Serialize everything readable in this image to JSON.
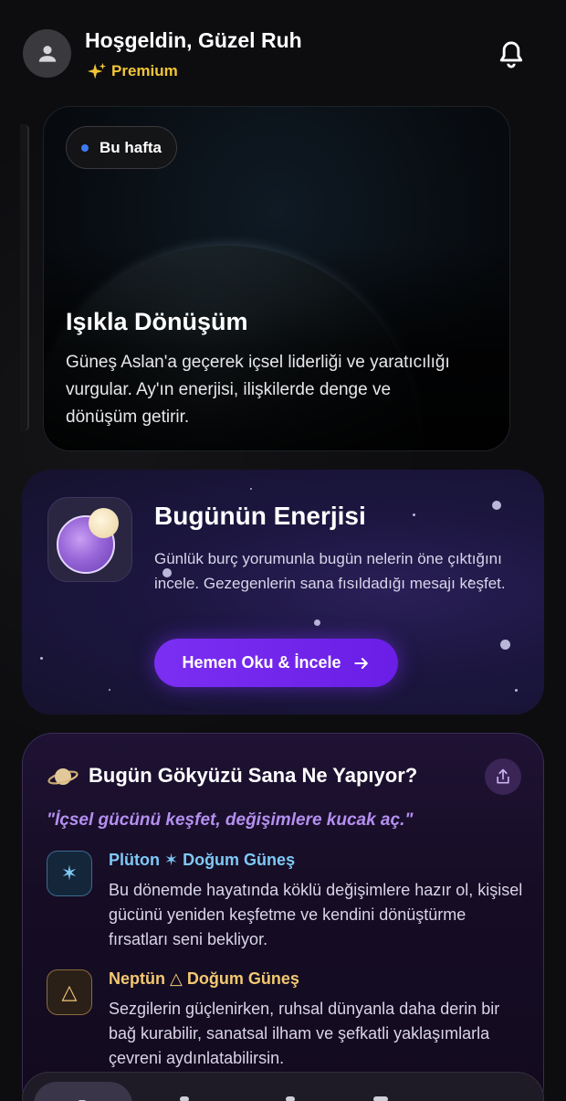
{
  "header": {
    "greeting": "Hoşgeldin, Güzel Ruh",
    "premium_label": "Premium",
    "icons": [
      "user-avatar-icon",
      "sparkles-icon",
      "bell-icon"
    ],
    "accent": "#f3c536"
  },
  "hero": {
    "chip_label": "Bu hafta",
    "title": "Işıkla Dönüşüm",
    "description": "Güneş Aslan'a geçerek içsel liderliği ve yaratıcılığı vurgular. Ay'ın enerjisi, ilişkilerde denge ve dönüşüm getirir.",
    "chip_dot_color": "#3d7bf5"
  },
  "energy": {
    "title": "Bugünün Enerjisi",
    "description": "Günlük burç yorumunla bugün nelerin öne çıktığını incele. Gezegenlerin sana fısıldadığı mesajı keşfet.",
    "button_label": "Hemen Oku & İncele",
    "button_arrow": "→",
    "button_color": "#7b2ff2"
  },
  "sky": {
    "title": "Bugün Gökyüzü Sana Ne Yapıyor?",
    "quote": "\"İçsel gücünü keşfet, değişimlere kucak aç.\"",
    "transits": [
      {
        "symbol": "✶",
        "title": "Plüton ✶ Doğum Güneş",
        "text": "Bu dönemde hayatında köklü değişimlere hazır ol, kişisel gücünü yeniden keşfetme ve kendini dönüştürme fırsatları seni bekliyor.",
        "color": "#7ec9f5"
      },
      {
        "symbol": "△",
        "title": "Neptün △ Doğum Güneş",
        "text": "Sezgilerin güçlenirken, ruhsal dünyanla daha derin bir bağ kurabilir, sanatsal ilham ve şefkatli yaklaşımlarla çevreni aydınlatabilirsin.",
        "color": "#f3c871"
      }
    ]
  }
}
